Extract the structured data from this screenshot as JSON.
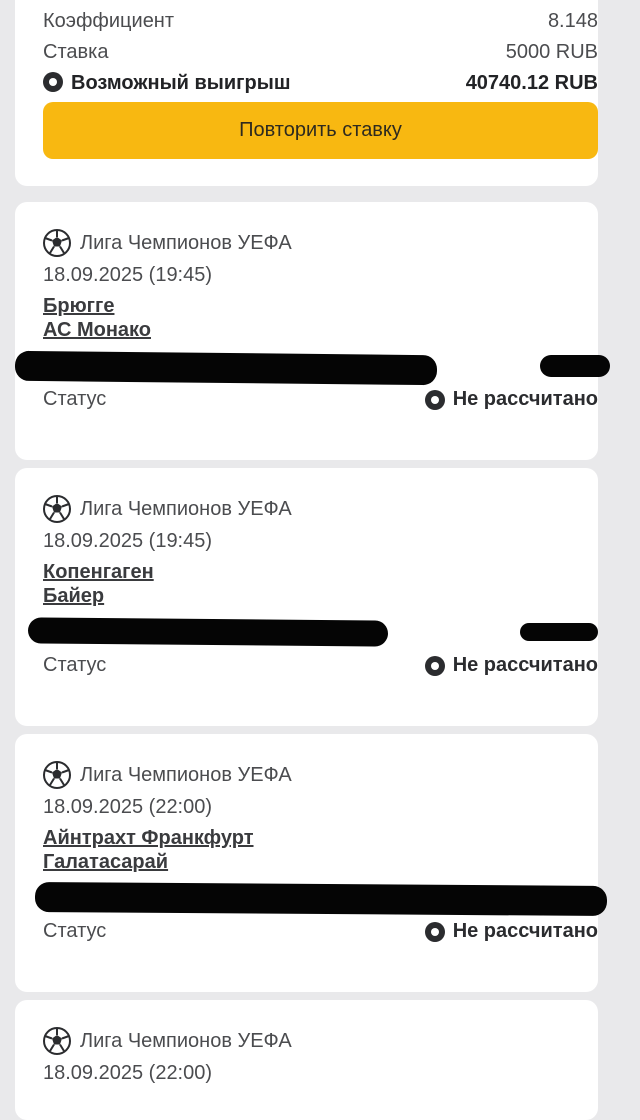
{
  "summary": {
    "coef_label": "Коэффициент",
    "coef_value": "8.148",
    "stake_label": "Ставка",
    "stake_value": "5000 RUB",
    "win_label": "Возможный выигрыш",
    "win_value": "40740.12 RUB",
    "repeat_button": "Повторить ставку"
  },
  "events": [
    {
      "league": "Лига Чемпионов УЕФА",
      "date": "18.09.2025 (19:45)",
      "team1": "Брюгге",
      "team2": "АС Монако",
      "status_label": "Статус",
      "status_value": "Не рассчитано"
    },
    {
      "league": "Лига Чемпионов УЕФА",
      "date": "18.09.2025 (19:45)",
      "team1": "Копенгаген",
      "team2": "Байер",
      "status_label": "Статус",
      "status_value": "Не рассчитано"
    },
    {
      "league": "Лига Чемпионов УЕФА",
      "date": "18.09.2025 (22:00)",
      "team1": "Айнтрахт Франкфурт",
      "team2": "Галатасарай",
      "status_label": "Статус",
      "status_value": "Не рассчитано"
    },
    {
      "league": "Лига Чемпионов УЕФА",
      "date": "18.09.2025 (22:00)"
    }
  ],
  "colors": {
    "accent": "#f8b811",
    "background": "#e9e9eb",
    "card": "#ffffff"
  }
}
